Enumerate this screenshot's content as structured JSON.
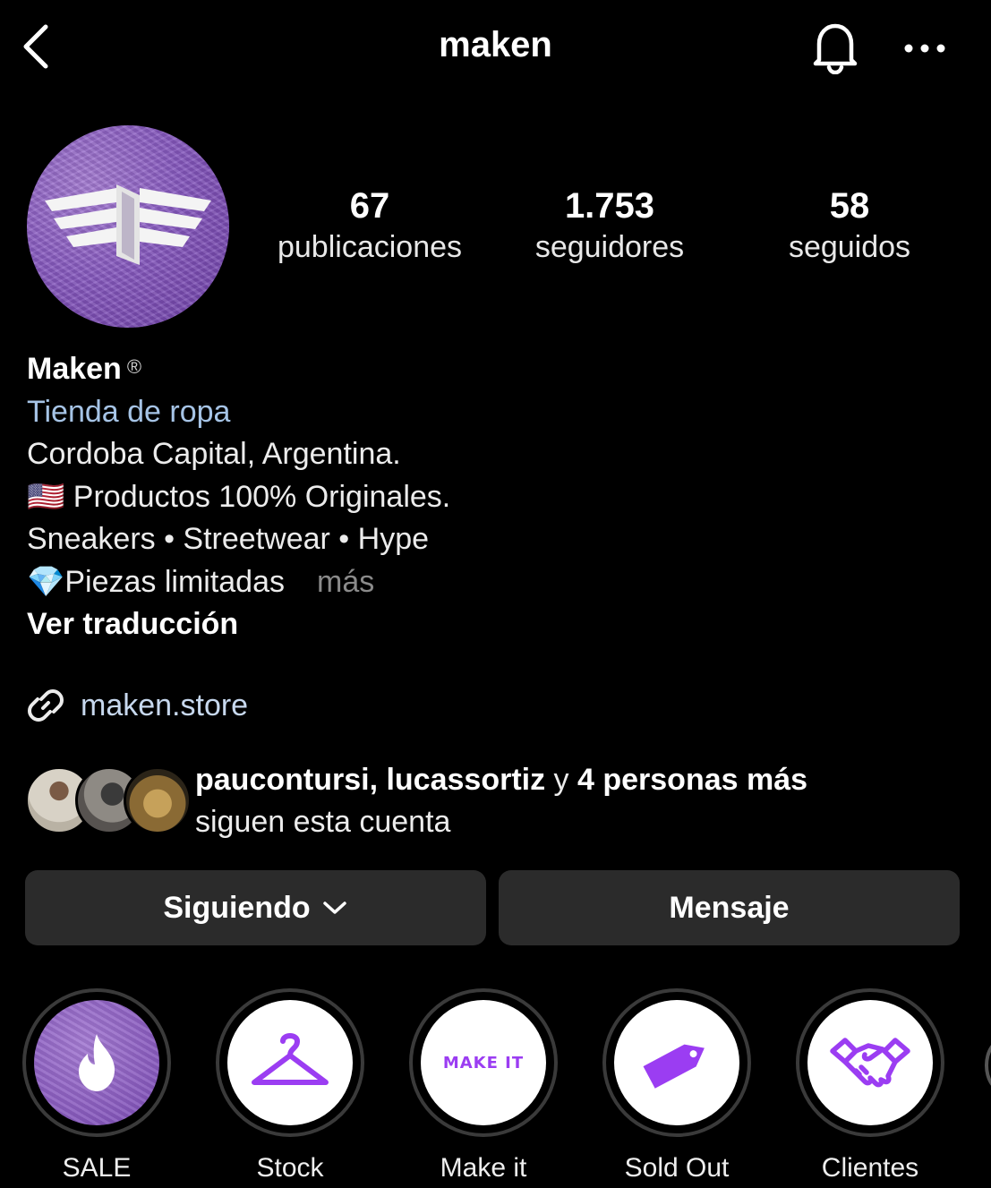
{
  "header": {
    "username": "maken",
    "icons": {
      "back": "chevron-left-icon",
      "bell": "bell-icon",
      "more": "more-horizontal-icon"
    }
  },
  "profile": {
    "stats": [
      {
        "value": "67",
        "label": "publicaciones"
      },
      {
        "value": "1.753",
        "label": "seguidores"
      },
      {
        "value": "58",
        "label": "seguidos"
      }
    ],
    "name": "Maken",
    "registered_mark": "®",
    "category": "Tienda de ropa",
    "bio_lines": [
      "Cordoba Capital, Argentina.",
      "🇺🇸 Productos 100% Originales.",
      "Sneakers • Streetwear • Hype",
      "💎Piezas limitadas"
    ],
    "more_label": "más",
    "translate_label": "Ver traducción",
    "website": "maken.store"
  },
  "followed_by": {
    "names": "paucontursi, lucassortiz",
    "connector": " y ",
    "others": "4 personas más",
    "suffix": "siguen esta cuenta"
  },
  "actions": {
    "following_label": "Siguiendo",
    "message_label": "Mensaje"
  },
  "highlights": [
    {
      "label": "SALE",
      "icon": "flame-icon"
    },
    {
      "label": "Stock",
      "icon": "hanger-icon"
    },
    {
      "label": "Make it",
      "icon": "make-it-logo",
      "text": "MAKE IT"
    },
    {
      "label": "Sold Out",
      "icon": "price-tag-icon"
    },
    {
      "label": "Clientes",
      "icon": "handshake-icon"
    }
  ],
  "colors": {
    "background": "#000000",
    "button": "#2b2b2b",
    "category": "#a6c4e6",
    "link": "#c7d8ee",
    "accent_purple": "#9b3df2",
    "muted": "#8a8a8a"
  }
}
